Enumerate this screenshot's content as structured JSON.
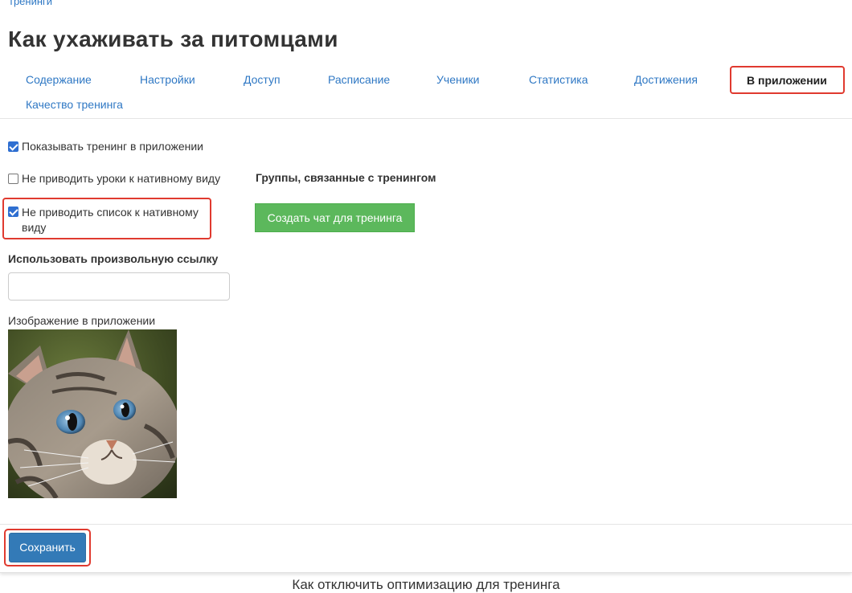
{
  "breadcrumb": "тренинги",
  "page_title": "Как ухаживать за питомцами",
  "tabs": [
    {
      "label": "Содержание"
    },
    {
      "label": "Настройки"
    },
    {
      "label": "Доступ"
    },
    {
      "label": "Расписание"
    },
    {
      "label": "Ученики"
    },
    {
      "label": "Статистика"
    },
    {
      "label": "Достижения"
    },
    {
      "label": "В приложении",
      "active": true
    },
    {
      "label": "Качество тренинга"
    }
  ],
  "settings": {
    "show_in_app": {
      "label": "Показывать тренинг в приложении",
      "checked": true
    },
    "no_native_lessons": {
      "label": "Не приводить уроки к нативному виду",
      "checked": false
    },
    "no_native_list": {
      "label": "Не приводить список к нативному виду",
      "checked": true
    },
    "custom_link_label": "Использовать произвольную ссылку",
    "custom_link_value": "",
    "image_label": "Изображение в приложении"
  },
  "groups": {
    "heading": "Группы, связанные с тренингом",
    "create_chat_button": "Создать чат для тренинга"
  },
  "save_button": "Сохранить",
  "caption": "Как отключить оптимизацию для тренинга",
  "colors": {
    "link": "#2f78c4",
    "highlight": "#e03a2f",
    "green_button": "#5cb85c",
    "save_button": "#337ab7",
    "checkbox": "#2f6fd1"
  },
  "icons": [
    "checkbox-checked-icon",
    "checkbox-unchecked-icon"
  ]
}
